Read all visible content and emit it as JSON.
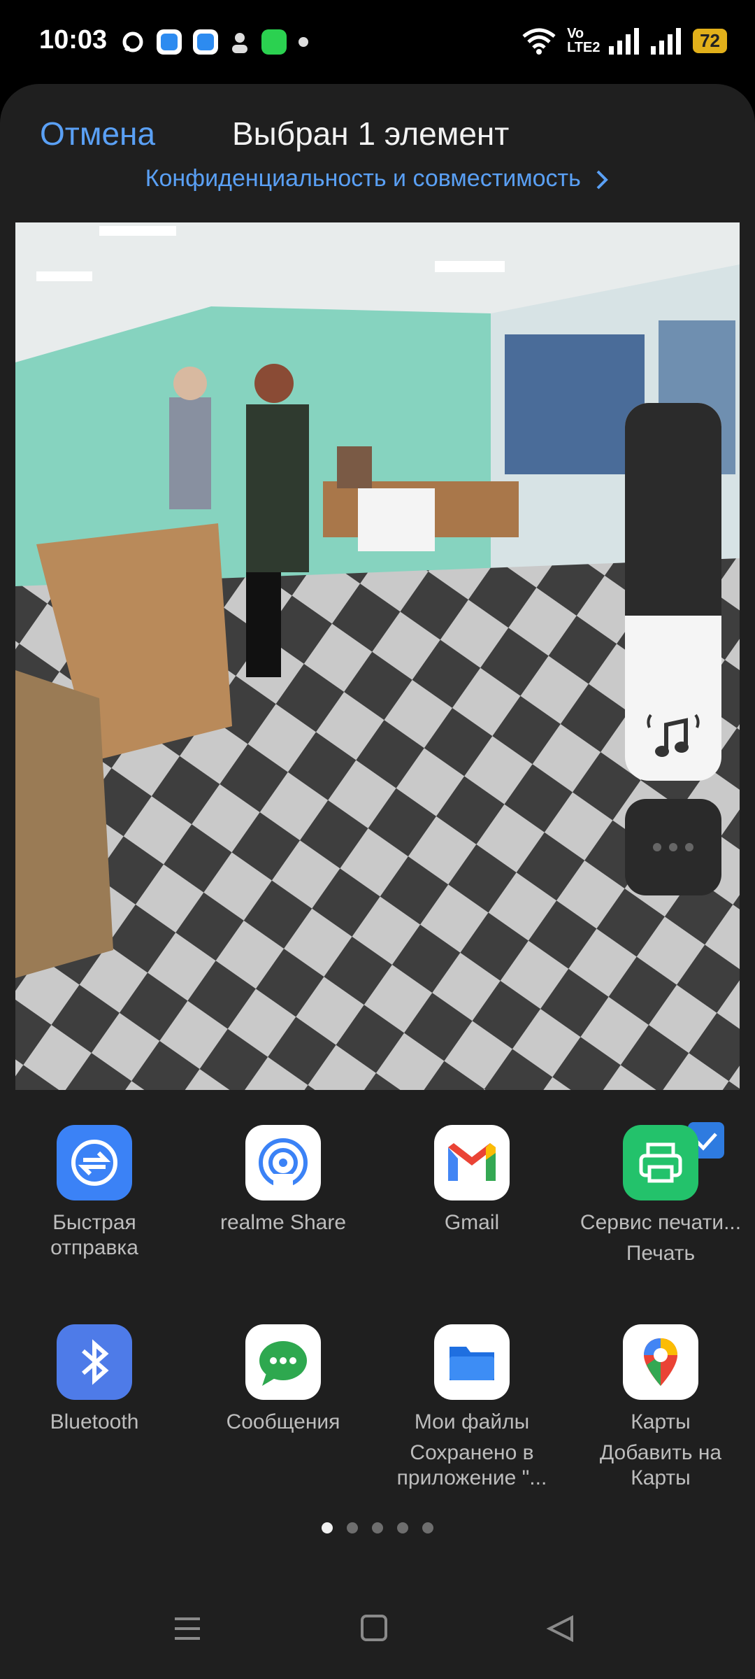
{
  "status_bar": {
    "time": "10:03",
    "network": "Vo LTE2",
    "battery": "72"
  },
  "header": {
    "cancel_label": "Отмена",
    "title": "Выбран 1 элемент",
    "privacy_link": "Конфиденциальность и совместимость"
  },
  "apps": [
    {
      "label": "Быстрая отправка",
      "sub": "",
      "icon": "quick-send-icon",
      "color": "#3b82f6"
    },
    {
      "label": "realme Share",
      "sub": "",
      "icon": "realme-share-icon",
      "color": "#ffffff"
    },
    {
      "label": "Gmail",
      "sub": "",
      "icon": "gmail-icon",
      "color": "#ffffff"
    },
    {
      "label": "Сервис печати...",
      "sub": "Печать",
      "icon": "print-icon",
      "color": "#23c26b"
    },
    {
      "label": "Bluetooth",
      "sub": "",
      "icon": "bluetooth-icon",
      "color": "#4e7be8"
    },
    {
      "label": "Сообщения",
      "sub": "",
      "icon": "messages-icon",
      "color": "#ffffff"
    },
    {
      "label": "Мои файлы",
      "sub": "Сохранено в приложение \"...",
      "icon": "folder-icon",
      "color": "#ffffff"
    },
    {
      "label": "Карты",
      "sub": "Добавить на Карты",
      "icon": "maps-icon",
      "color": "#ffffff"
    }
  ],
  "pagination": {
    "pages": 5,
    "current": 1
  },
  "colors": {
    "accent": "#5aa0f5",
    "sheet": "#1f1f1f"
  }
}
